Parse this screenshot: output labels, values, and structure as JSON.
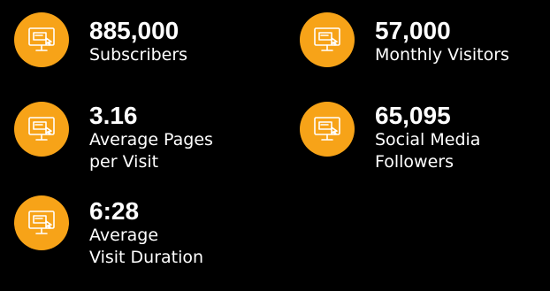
{
  "colors": {
    "background": "#000000",
    "badge": "#f7a318",
    "icon_stroke": "#ffffff",
    "text": "#ffffff"
  },
  "icon": "computer-monitor-cursor-icon",
  "stats": {
    "subscribers": {
      "value": "885,000",
      "label_line1": "Subscribers",
      "label_line2": ""
    },
    "monthly_visitors": {
      "value": "57,000",
      "label_line1": "Monthly Visitors",
      "label_line2": ""
    },
    "pages_per_visit": {
      "value": "3.16",
      "label_line1": "Average Pages",
      "label_line2": "per Visit"
    },
    "social_followers": {
      "value": "65,095",
      "label_line1": "Social Media",
      "label_line2": "Followers"
    },
    "visit_duration": {
      "value": "6:28",
      "label_line1": "Average",
      "label_line2": "Visit Duration"
    }
  }
}
